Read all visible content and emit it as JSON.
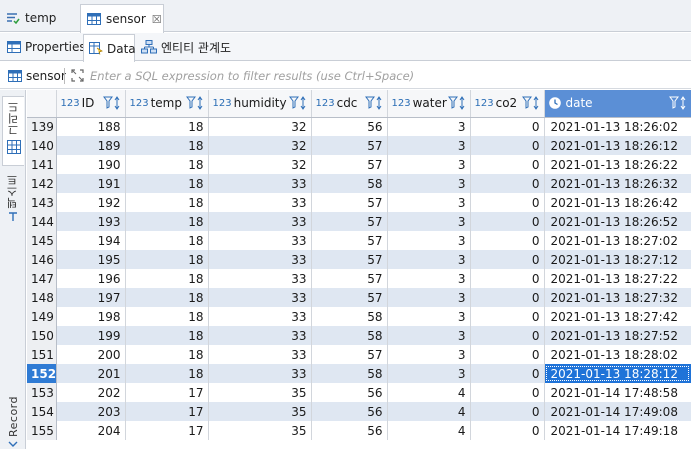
{
  "editor_tabs": [
    {
      "label": "temp",
      "icon": "table-edit-icon"
    },
    {
      "label": "sensor",
      "icon": "table-icon",
      "active": true
    }
  ],
  "sub_tabs": [
    {
      "label": "Properties",
      "icon": "properties-icon"
    },
    {
      "label": "Data",
      "icon": "data-icon",
      "active": true
    },
    {
      "label": "엔티티 관계도",
      "icon": "er-diagram-icon"
    }
  ],
  "filter": {
    "table_name": "sensor",
    "placeholder": "Enter a SQL expression to filter results (use Ctrl+Space)"
  },
  "side_tabs": {
    "grid": "그리드",
    "text": "텍스트",
    "record": "Record"
  },
  "columns": [
    {
      "type": "123",
      "name": "ID"
    },
    {
      "type": "123",
      "name": "temp"
    },
    {
      "type": "123",
      "name": "humidity"
    },
    {
      "type": "123",
      "name": "cdc"
    },
    {
      "type": "123",
      "name": "water"
    },
    {
      "type": "123",
      "name": "co2"
    },
    {
      "type": "",
      "name": "date"
    }
  ],
  "rows": [
    {
      "n": "139",
      "cells": [
        "188",
        "18",
        "32",
        "56",
        "3",
        "0",
        "2021-01-13 18:26:02"
      ]
    },
    {
      "n": "140",
      "cells": [
        "189",
        "18",
        "32",
        "57",
        "3",
        "0",
        "2021-01-13 18:26:12"
      ]
    },
    {
      "n": "141",
      "cells": [
        "190",
        "18",
        "32",
        "57",
        "3",
        "0",
        "2021-01-13 18:26:22"
      ]
    },
    {
      "n": "142",
      "cells": [
        "191",
        "18",
        "33",
        "58",
        "3",
        "0",
        "2021-01-13 18:26:32"
      ]
    },
    {
      "n": "143",
      "cells": [
        "192",
        "18",
        "33",
        "57",
        "3",
        "0",
        "2021-01-13 18:26:42"
      ]
    },
    {
      "n": "144",
      "cells": [
        "193",
        "18",
        "33",
        "57",
        "3",
        "0",
        "2021-01-13 18:26:52"
      ]
    },
    {
      "n": "145",
      "cells": [
        "194",
        "18",
        "33",
        "57",
        "3",
        "0",
        "2021-01-13 18:27:02"
      ]
    },
    {
      "n": "146",
      "cells": [
        "195",
        "18",
        "33",
        "57",
        "3",
        "0",
        "2021-01-13 18:27:12"
      ]
    },
    {
      "n": "147",
      "cells": [
        "196",
        "18",
        "33",
        "57",
        "3",
        "0",
        "2021-01-13 18:27:22"
      ]
    },
    {
      "n": "148",
      "cells": [
        "197",
        "18",
        "33",
        "57",
        "3",
        "0",
        "2021-01-13 18:27:32"
      ]
    },
    {
      "n": "149",
      "cells": [
        "198",
        "18",
        "33",
        "58",
        "3",
        "0",
        "2021-01-13 18:27:42"
      ]
    },
    {
      "n": "150",
      "cells": [
        "199",
        "18",
        "33",
        "58",
        "3",
        "0",
        "2021-01-13 18:27:52"
      ]
    },
    {
      "n": "151",
      "cells": [
        "200",
        "18",
        "33",
        "57",
        "3",
        "0",
        "2021-01-13 18:28:02"
      ]
    },
    {
      "n": "152",
      "cells": [
        "201",
        "18",
        "33",
        "58",
        "3",
        "0",
        "2021-01-13 18:28:12"
      ],
      "selected": true
    },
    {
      "n": "153",
      "cells": [
        "202",
        "17",
        "35",
        "56",
        "4",
        "0",
        "2021-01-14 17:48:58"
      ]
    },
    {
      "n": "154",
      "cells": [
        "203",
        "17",
        "35",
        "56",
        "4",
        "0",
        "2021-01-14 17:49:08"
      ]
    },
    {
      "n": "155",
      "cells": [
        "204",
        "17",
        "35",
        "56",
        "4",
        "0",
        "2021-01-14 17:49:18"
      ]
    }
  ],
  "colors": {
    "selection": "#1f73d8",
    "row_stripe": "#dfe7f2",
    "header_active": "#5b8fd6",
    "accent_blue": "#2a6db5"
  }
}
